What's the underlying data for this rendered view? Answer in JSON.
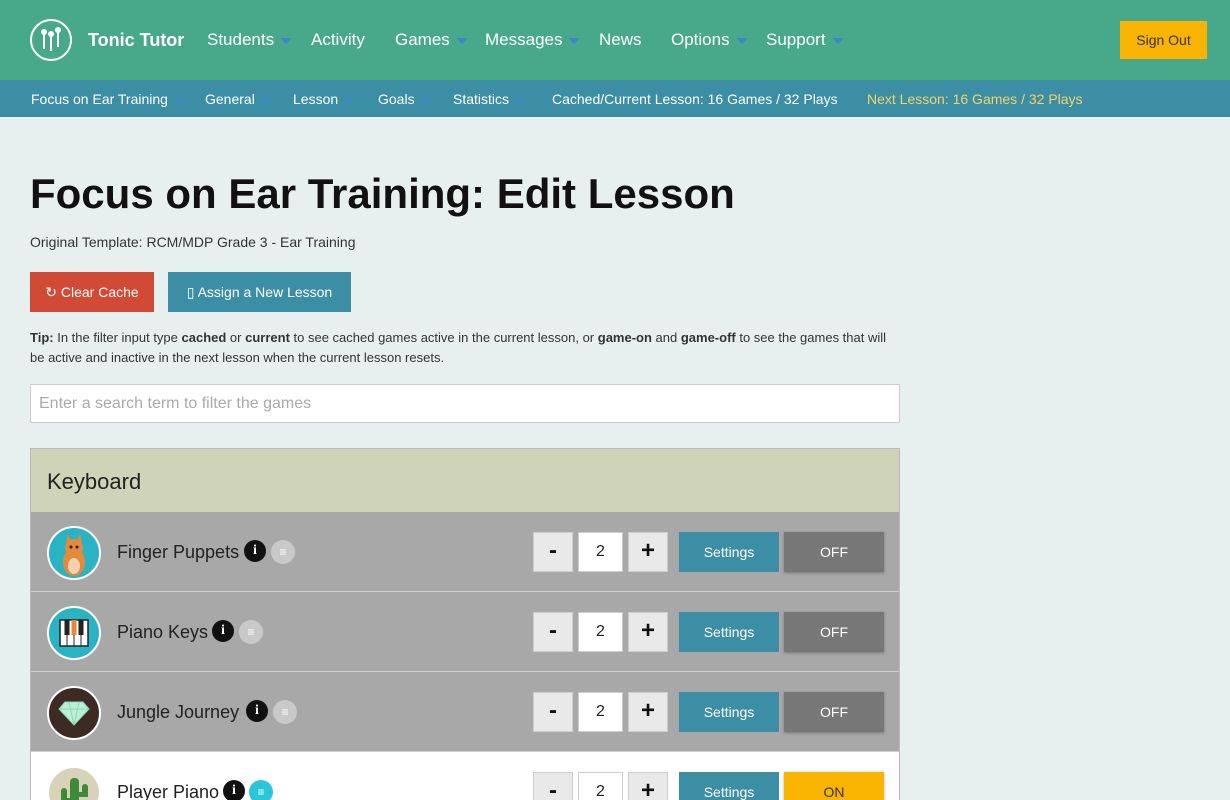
{
  "header": {
    "brand": "Tonic Tutor",
    "nav": [
      "Students",
      "Activity",
      "Games",
      "Messages",
      "News",
      "Options",
      "Support"
    ],
    "sign_out": "Sign Out"
  },
  "subnav": {
    "items": [
      "Focus on Ear Training",
      "General",
      "Lesson",
      "Goals",
      "Statistics"
    ],
    "cached": "Cached/Current Lesson: 16 Games / 32 Plays",
    "next": "Next Lesson: 16 Games / 32 Plays"
  },
  "page": {
    "title": "Focus on Ear Training: Edit Lesson",
    "template": "Original Template: RCM/MDP Grade 3 - Ear Training",
    "clear_cache": "Clear Cache",
    "assign_lesson": "Assign a New Lesson",
    "tip": {
      "label": "Tip:",
      "t1": " In the filter input type ",
      "k1": "cached",
      "t2": " or ",
      "k2": "current",
      "t3": " to see cached games active in the current lesson, or ",
      "k3": "game-on",
      "t4": " and ",
      "k4": "game-off",
      "t5": " to see the games that will be active and inactive in the next lesson when the current lesson resets."
    },
    "search_placeholder": "Enter a search term to filter the games"
  },
  "panel": {
    "title": "Keyboard",
    "games": [
      {
        "name": "Finger Puppets",
        "qty": "2",
        "settings": "Settings",
        "state": "OFF"
      },
      {
        "name": "Piano Keys",
        "qty": "2",
        "settings": "Settings",
        "state": "OFF"
      },
      {
        "name": "Jungle Journey",
        "qty": "2",
        "settings": "Settings",
        "state": "OFF"
      },
      {
        "name": "Player Piano",
        "qty": "2",
        "settings": "Settings",
        "state": "ON"
      }
    ],
    "minus": "-",
    "plus": "+",
    "info": "i",
    "list": "≡"
  },
  "colors": {
    "header": "#48a98a",
    "subnav": "#3b8ea3",
    "accent": "#f8b400",
    "danger": "#d04a35"
  }
}
